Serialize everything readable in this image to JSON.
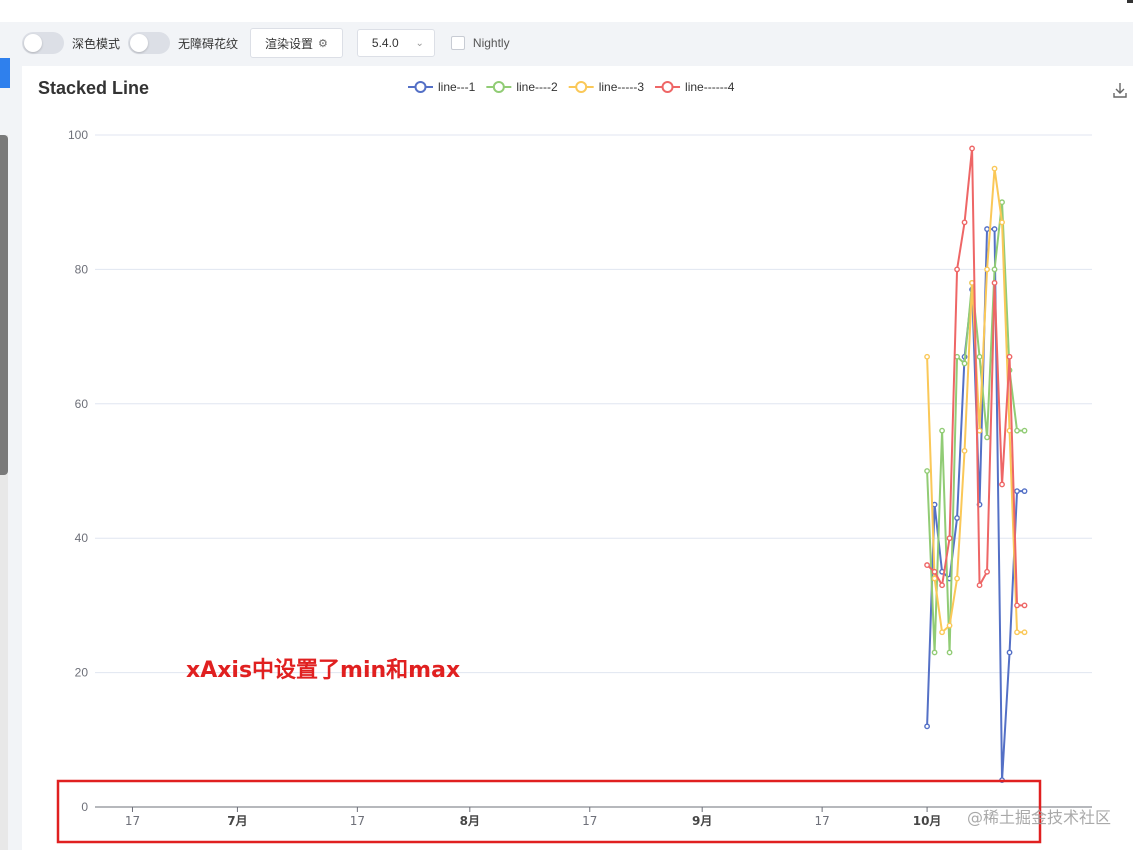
{
  "toolbar": {
    "dark_mode_label": "深色模式",
    "aria_label": "无障碍花纹",
    "render_settings_label": "渲染设置",
    "version": "5.4.0",
    "nightly_label": "Nightly"
  },
  "annotation": {
    "text": "xAxis中设置了min和max",
    "color": "#e02020"
  },
  "watermark": "@稀土掘金技术社区",
  "chart_data": {
    "type": "line",
    "title": "Stacked Line",
    "xlabel": "",
    "ylabel": "",
    "ylim": [
      0,
      100
    ],
    "yticks": [
      0,
      20,
      40,
      60,
      80,
      100
    ],
    "xlim": [
      "2021-06-12",
      "2021-10-23"
    ],
    "xtick_labels": [
      "17",
      "7月",
      "17",
      "8月",
      "17",
      "9月",
      "17",
      "10月"
    ],
    "xtick_bold": [
      false,
      true,
      false,
      true,
      false,
      true,
      false,
      true
    ],
    "xtick_dates": [
      "2021-06-17",
      "2021-07-01",
      "2021-07-17",
      "2021-08-01",
      "2021-08-17",
      "2021-09-01",
      "2021-09-17",
      "2021-10-01"
    ],
    "legend_position": "top-center",
    "grid": true,
    "x": [
      "2021-10-01",
      "2021-10-02",
      "2021-10-03",
      "2021-10-04",
      "2021-10-05",
      "2021-10-06",
      "2021-10-07",
      "2021-10-08",
      "2021-10-09",
      "2021-10-10",
      "2021-10-11",
      "2021-10-12",
      "2021-10-13",
      "2021-10-14"
    ],
    "series": [
      {
        "name": "line---1",
        "color": "#5470c6",
        "values": [
          12,
          45,
          35,
          34,
          43,
          67,
          77,
          45,
          86,
          86,
          4,
          23,
          47,
          47
        ]
      },
      {
        "name": "line----2",
        "color": "#91cc75",
        "values": [
          50,
          23,
          56,
          23,
          67,
          66,
          78,
          67,
          55,
          80,
          90,
          65,
          56,
          56
        ]
      },
      {
        "name": "line-----3",
        "color": "#fac858",
        "values": [
          67,
          34,
          26,
          27,
          34,
          53,
          78,
          56,
          80,
          95,
          87,
          56,
          26,
          26
        ]
      },
      {
        "name": "line------4",
        "color": "#ee6666",
        "values": [
          36,
          35,
          33,
          40,
          80,
          87,
          98,
          33,
          35,
          78,
          48,
          67,
          30,
          30
        ]
      }
    ]
  }
}
